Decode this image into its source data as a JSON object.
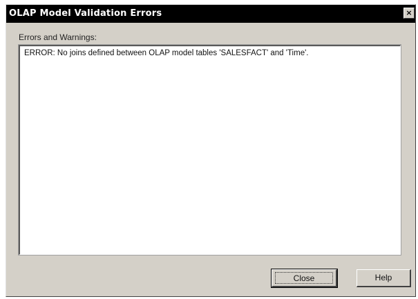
{
  "window": {
    "title": "OLAP Model Validation Errors",
    "close_glyph": "×"
  },
  "errors": {
    "label": "Errors and Warnings:",
    "items": [
      "ERROR: No joins defined between OLAP model tables 'SALESFACT' and 'Time'."
    ]
  },
  "buttons": {
    "close_label": "Close",
    "help_label": "Help"
  }
}
